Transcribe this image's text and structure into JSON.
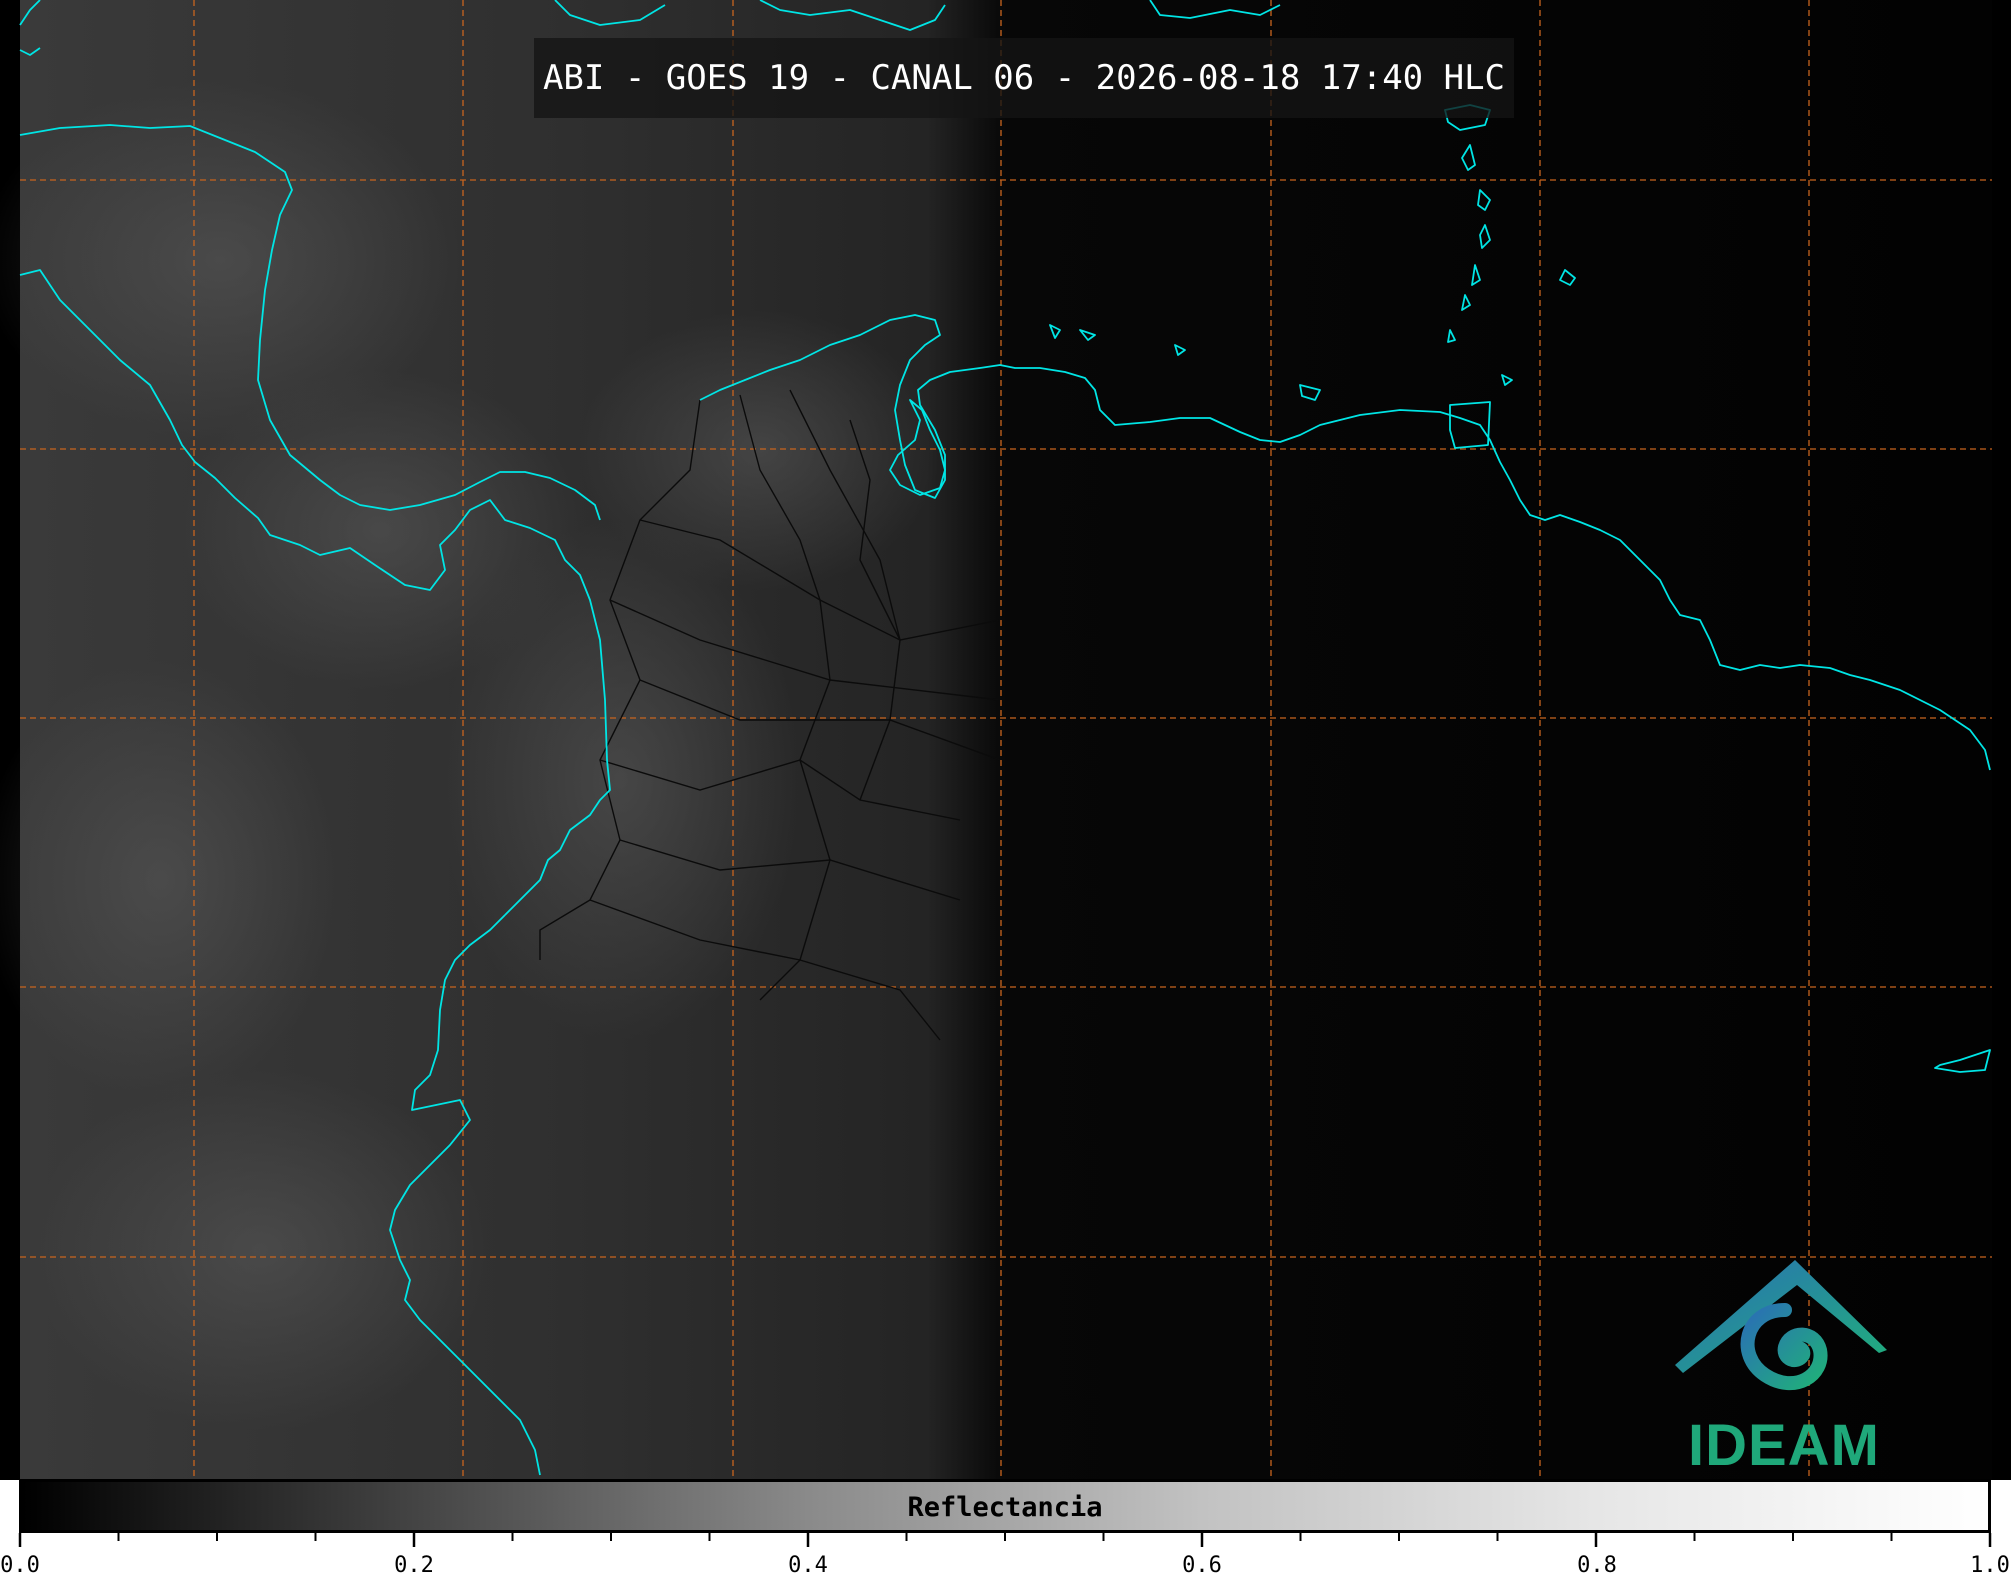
{
  "title": "ABI - GOES 19 - CANAL 06 - 2026-08-18 17:40 HLC",
  "colorbar": {
    "label": "Reflectancia",
    "min": 0.0,
    "max": 1.0,
    "tick_labels": [
      "0.0",
      "0.2",
      "0.4",
      "0.6",
      "0.8",
      "1.0"
    ]
  },
  "logo": {
    "text": "IDEAM"
  },
  "colors": {
    "coastline": "#00e5e5",
    "gridline": "#c8641e",
    "background": "#000000",
    "logo_text": "#1fa87a"
  }
}
